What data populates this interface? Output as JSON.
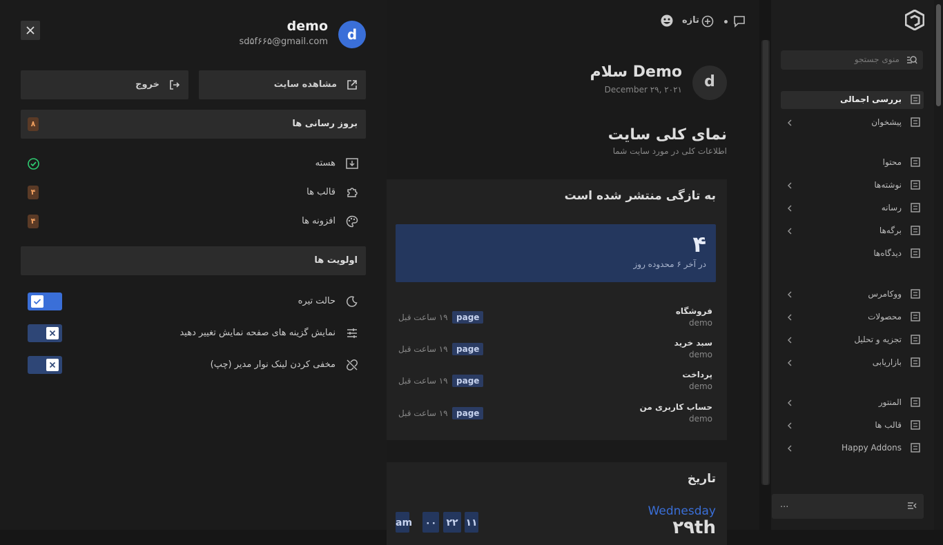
{
  "colors": {
    "accent": "#3a6fd8",
    "badge": "#5a3a26",
    "badge_text": "#f0a060",
    "page_badge": "#2b3c63",
    "success": "#2ecc71"
  },
  "sidebar": {
    "search_placeholder": "منوی جستجو",
    "items": [
      {
        "label": "بررسی اجمالی",
        "icon": "dashboard-icon",
        "active": true,
        "chevron": false
      },
      {
        "label": "پیشخوان",
        "icon": "grid-icon",
        "chevron": true
      },
      {
        "label": "محتوا",
        "icon": "content-icon",
        "chevron": false
      },
      {
        "label": "نوشته‌ها",
        "icon": "posts-icon",
        "chevron": true
      },
      {
        "label": "رسانه",
        "icon": "media-icon",
        "chevron": true
      },
      {
        "label": "برگه‌ها",
        "icon": "pages-icon",
        "chevron": true
      },
      {
        "label": "دیدگاه‌ها",
        "icon": "comments-icon",
        "chevron": false
      },
      {
        "label": "ووکامرس",
        "icon": "woo-icon",
        "chevron": true
      },
      {
        "label": "محصولات",
        "icon": "products-icon",
        "chevron": true
      },
      {
        "label": "تجزیه و تحلیل",
        "icon": "analytics-icon",
        "chevron": true
      },
      {
        "label": "بازاریابی",
        "icon": "marketing-icon",
        "chevron": true
      },
      {
        "label": "المنتور",
        "icon": "elementor-icon",
        "chevron": true
      },
      {
        "label": "قالب ها",
        "icon": "templates-icon",
        "chevron": true
      },
      {
        "label": "Happy Addons",
        "icon": "happy-icon",
        "chevron": true
      }
    ],
    "footer_more": "..."
  },
  "topbar": {
    "new_label": "تازه"
  },
  "main": {
    "greeting": "سلام Demo",
    "date": "December ۲۹, ۲۰۲۱",
    "avatar_letter": "d",
    "overview_title": "نمای کلی سایت",
    "overview_subtitle": "اطلاعات کلی در مورد سایت شما",
    "recent_title": "به تازگی منتشر شده است",
    "stat_value": "۴",
    "stat_label": "در آخر ۶ محدوده روز",
    "posts": [
      {
        "title": "فروشگاه",
        "author": "demo",
        "type": "page",
        "time": "۱۹ ساعت قبل"
      },
      {
        "title": "سبد خرید",
        "author": "demo",
        "type": "page",
        "time": "۱۹ ساعت قبل"
      },
      {
        "title": "پرداخت",
        "author": "demo",
        "type": "page",
        "time": "۱۹ ساعت قبل"
      },
      {
        "title": "حساب کاربری من",
        "author": "demo",
        "type": "page",
        "time": "۱۹ ساعت قبل"
      }
    ],
    "date_card": {
      "title": "تاریخ",
      "weekday": "Wednesday",
      "day": "۲۹th",
      "time_parts": [
        "am",
        "۰۰",
        "۲۲",
        "۱۱"
      ]
    }
  },
  "panel": {
    "user_name": "demo",
    "user_email": "sd۵f۶۶۵@gmail.com",
    "avatar_letter": "d",
    "view_site": "مشاهده سایت",
    "logout": "خروج",
    "updates": {
      "title": "بروز رسانی ها",
      "count": "۸",
      "rows": [
        {
          "label": "هسته",
          "icon": "download-icon",
          "status": "ok"
        },
        {
          "label": "قالب ها",
          "icon": "puzzle-icon",
          "count": "۴"
        },
        {
          "label": "افزونه ها",
          "icon": "palette-icon",
          "count": "۴"
        }
      ]
    },
    "prefs": {
      "title": "اولویت ها",
      "rows": [
        {
          "label": "حالت تیره",
          "icon": "moon-icon",
          "on": true
        },
        {
          "label": "نمایش گزینه های صفحه نمایش تغییر دهید",
          "icon": "sliders-icon",
          "on": false
        },
        {
          "label": "مخفی کردن لینک نوار مدیر (چپ)",
          "icon": "unlink-icon",
          "on": false
        }
      ]
    }
  }
}
